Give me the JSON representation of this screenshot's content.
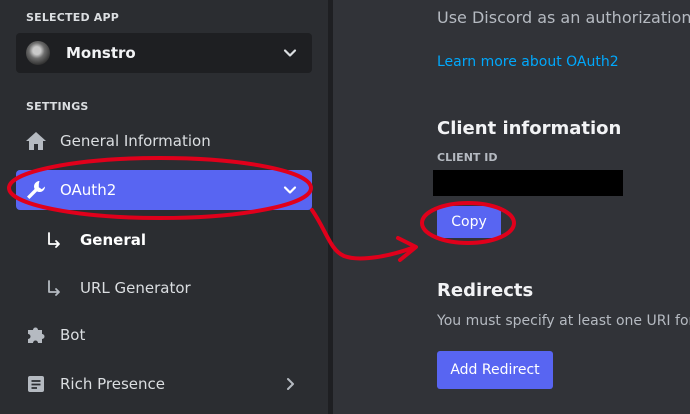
{
  "sidebar": {
    "selected_app_label": "SELECTED APP",
    "app_name": "Monstro",
    "settings_label": "SETTINGS",
    "items": [
      {
        "label": "General Information",
        "icon": "home-icon"
      },
      {
        "label": "OAuth2",
        "icon": "wrench-icon",
        "active": true
      },
      {
        "label": "General",
        "icon": "sub-arrow-icon",
        "sub": true
      },
      {
        "label": "URL Generator",
        "icon": "sub-arrow-icon",
        "sub": true
      },
      {
        "label": "Bot",
        "icon": "puzzle-icon"
      },
      {
        "label": "Rich Presence",
        "icon": "document-icon"
      }
    ]
  },
  "main": {
    "intro_text": "Use Discord as an authorization",
    "learn_more_link": "Learn more about OAuth2",
    "client_info_heading": "Client information",
    "client_id_label": "CLIENT ID",
    "copy_button": "Copy",
    "redirects_heading": "Redirects",
    "redirects_text": "You must specify at least one URI for",
    "add_redirect_button": "Add Redirect"
  },
  "colors": {
    "accent": "#5865f2",
    "link": "#00a8fc",
    "annotation": "#e0001b"
  }
}
